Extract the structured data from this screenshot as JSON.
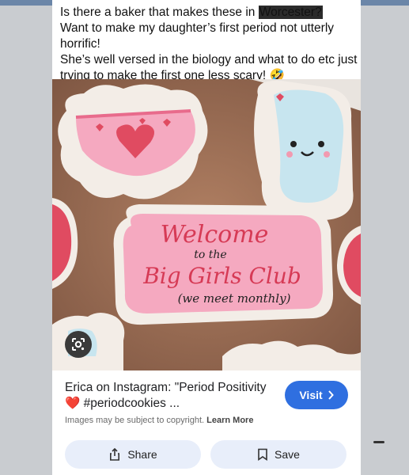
{
  "post": {
    "line1_before": "Is there a baker that makes these in ",
    "line1_highlight": "Worcester?",
    "line2": "Want to make my daughter’s first period not utterly horrific!",
    "line3": "She’s well versed in the biology and what to do etc just trying to make the first one less scary! 🤣"
  },
  "image": {
    "cookie_main_line1": "Welcome",
    "cookie_main_line2": "to the",
    "cookie_main_line3": "Big Girls Club",
    "cookie_main_line4": "(we meet monthly)",
    "lens_icon": "google-lens-icon"
  },
  "result": {
    "title": "Erica on Instagram: \"Period Positivity ❤️ #periodcookies ...",
    "visit_label": "Visit",
    "copyright_text": "Images may be subject to copyright.",
    "learn_more": "Learn More"
  },
  "actions": {
    "share_label": "Share",
    "save_label": "Save"
  },
  "colors": {
    "page_bg": "#c9ccd0",
    "visit_button": "#2f6fe0",
    "pill_bg": "#e8eefa",
    "cookie_pink": "#f2a1b6",
    "cookie_red": "#d63a55"
  }
}
